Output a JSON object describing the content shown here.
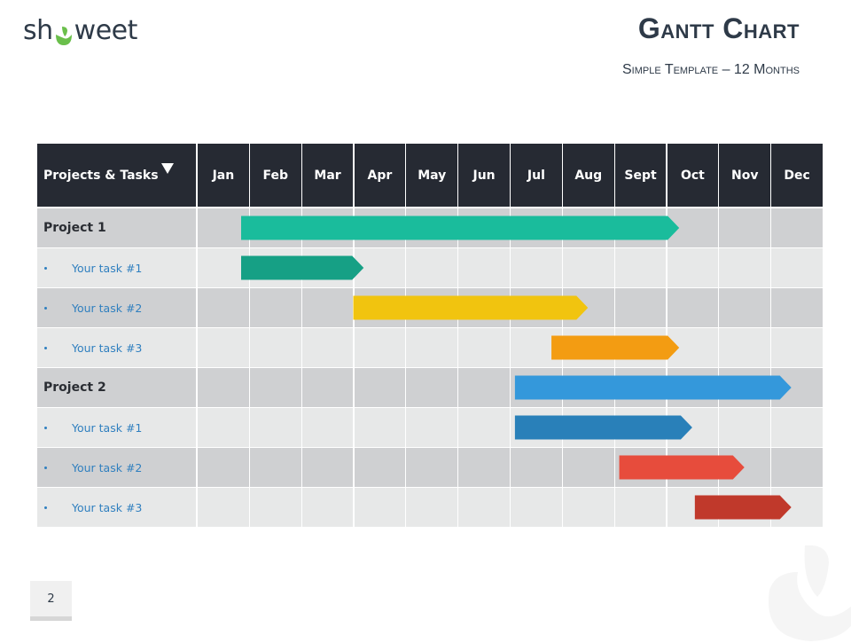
{
  "brand": {
    "logo_text_before": "sh",
    "logo_text_after": "weet",
    "logo_icon": "smile-drop-icon",
    "logo_color": "#6abf4b"
  },
  "header": {
    "title": "Gantt Chart",
    "subtitle": "Simple Template – 12 Months"
  },
  "page_number": "2",
  "colors": {
    "header_bg": "#262a33",
    "row_dark": "#cfd0d2",
    "row_light": "#e7e8e8",
    "grid_line": "#ffffff",
    "task_text": "#2f7fbf"
  },
  "chart_data": {
    "type": "gantt",
    "title": "Gantt Chart",
    "subtitle": "Simple Template – 12 Months",
    "first_column_header": "Projects & Tasks",
    "first_column_icon": "sort-down-triangle-icon",
    "months": [
      "Jan",
      "Feb",
      "Mar",
      "Apr",
      "May",
      "Jun",
      "Jul",
      "Aug",
      "Sept",
      "Oct",
      "Nov",
      "Dec"
    ],
    "x_unit": "months from start of Jan",
    "xlim": [
      0,
      12
    ],
    "rows": [
      {
        "label": "Project 1",
        "kind": "project",
        "start": 0.85,
        "end": 9.25,
        "color": "#1abc9c"
      },
      {
        "label": "Your task #1",
        "kind": "task",
        "start": 0.85,
        "end": 3.2,
        "color": "#16a085"
      },
      {
        "label": "Your task #2",
        "kind": "task",
        "start": 3.0,
        "end": 7.5,
        "color": "#f1c40f"
      },
      {
        "label": "Your task #3",
        "kind": "task",
        "start": 6.8,
        "end": 9.25,
        "color": "#f39c12"
      },
      {
        "label": "Project 2",
        "kind": "project",
        "start": 6.1,
        "end": 11.4,
        "color": "#3498db"
      },
      {
        "label": "Your task #1",
        "kind": "task",
        "start": 6.1,
        "end": 9.5,
        "color": "#2980b9"
      },
      {
        "label": "Your task #2",
        "kind": "task",
        "start": 8.1,
        "end": 10.5,
        "color": "#e74c3c"
      },
      {
        "label": "Your task #3",
        "kind": "task",
        "start": 9.55,
        "end": 11.4,
        "color": "#c0392b"
      }
    ]
  }
}
